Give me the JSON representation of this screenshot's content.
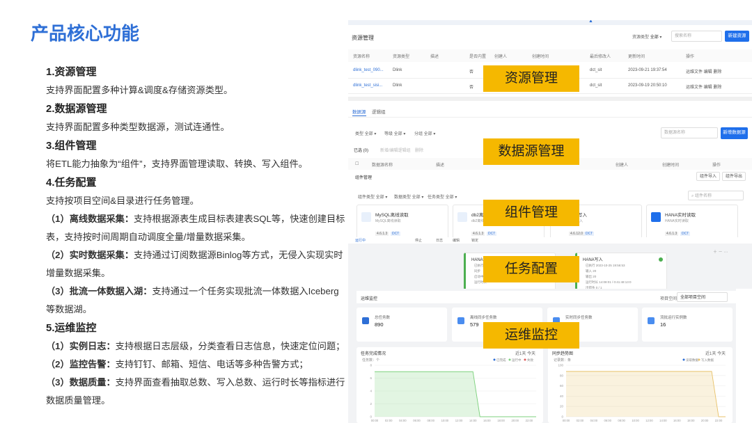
{
  "page": {
    "title": "产品核心功能"
  },
  "features": [
    {
      "heading": "1.资源管理",
      "lines": [
        {
          "bold": "",
          "text": "支持界面配置多种计算&调度&存储资源类型。"
        }
      ]
    },
    {
      "heading": "2.数据源管理",
      "lines": [
        {
          "bold": "",
          "text": "支持界面配置多种类型数据源，测试连通性。"
        }
      ]
    },
    {
      "heading": "3.组件管理",
      "lines": [
        {
          "bold": "",
          "text": "将ETL能力抽象为“组件”，支持界面管理读取、转换、写入组件。"
        }
      ]
    },
    {
      "heading": "4.任务配置",
      "lines": [
        {
          "bold": "",
          "text": "支持按项目空间&目录进行任务管理。"
        },
        {
          "bold": "（1）离线数据采集：",
          "text": "支持根据源表生成目标表建表SQL等，快速创建目标表，支持按时间周期自动调度全量/增量数据采集。"
        },
        {
          "bold": "（2）实时数据采集：",
          "text": "支持通过订阅数据源Binlog等方式，无侵入实现实时增量数据采集。"
        },
        {
          "bold": "（3）批流一体数据入湖：",
          "text": "支持通过一个任务实现批流一体数据入Iceberg等数据湖。"
        }
      ]
    },
    {
      "heading": "5.运维监控",
      "lines": [
        {
          "bold": "（1）实例日志：",
          "text": "支持根据日志层级，分类查看日志信息，快速定位问题；"
        },
        {
          "bold": "（2）监控告警：",
          "text": "支持钉钉、邮箱、短信、电话等多种告警方式；"
        },
        {
          "bold": "（3）数据质量：",
          "text": "支持界面查看抽取总数、写入总数、运行时长等指标进行数据质量管理。"
        }
      ]
    }
  ],
  "overlays": [
    "资源管理",
    "数据源管理",
    "组件管理",
    "任务配置",
    "运维监控"
  ],
  "resource": {
    "title": "资源管理",
    "filter_label": "资源类型",
    "filter_value": "全部",
    "search_placeholder": "搜索名称",
    "new_button": "新建资源",
    "columns": [
      "资源名称",
      "资源类型",
      "描述",
      "是否内置",
      "创建人",
      "创建时间",
      "最后修改人",
      "更新时间",
      "操作"
    ],
    "rows": [
      {
        "name": "dlink_test_090...",
        "type": "Dlink",
        "builtin": "否",
        "modifier": "dct_sit",
        "updated": "2023-09-21 19:37:54",
        "ops": "运维文件  编辑  删除"
      },
      {
        "name": "dlink_test_sisi...",
        "type": "Dlink",
        "builtin": "否",
        "modifier": "dct_sit",
        "updated": "2023-09-19 20:50:10",
        "ops": "运维文件  编辑  删除"
      }
    ]
  },
  "datasource": {
    "tabs": [
      "数据源",
      "逻辑组"
    ],
    "filters": [
      "类型  全部",
      "等级  全部",
      "分组  全部"
    ],
    "search_placeholder": "数据源名称",
    "new_button": "新增数据源",
    "selected": "已选 (0)",
    "batch": "新增/编辑逻辑组",
    "delete": "删除",
    "columns": [
      "数据源名称",
      "描述",
      "创建人",
      "创建时间",
      "操作"
    ]
  },
  "components": {
    "title": "组件管理",
    "btn1": "组件导入",
    "btn2": "组件导出",
    "filters": [
      "组件类型  全部",
      "数据类型  全部",
      "任务类型  全部"
    ],
    "search_placeholder": "组件名称",
    "cards": [
      {
        "name": "MySQL离线读取",
        "sub": "MySQL离线读取",
        "ver": "4.6.1.3",
        "tag": "DCT"
      },
      {
        "name": "db2离线读取",
        "sub": "db2离线读取",
        "ver": "4.6.1.3",
        "tag": "DCT"
      },
      {
        "name": "离线写入",
        "sub": "离线写入",
        "ver": "4.6.12.0",
        "tag": "DCT"
      },
      {
        "name": "HANA实时读取",
        "sub": "HANA实时读取",
        "ver": "4.6.1.3",
        "tag": "DCT"
      }
    ]
  },
  "task": {
    "toolbar": [
      "运行中",
      "停止",
      "日志",
      "编辑",
      "锁定"
    ],
    "node1": {
      "name": "HANA读取",
      "lines": [
        "已执行",
        "同步",
        "启动中",
        "运行时长"
      ]
    },
    "node2": {
      "name": "HANA写入",
      "lines": [
        "已执行  2023-10-25 19:56:53",
        "输入  20",
        "输出  20",
        "运行时长  14:08:01 / 0:41:48:13:0",
        "出错条  0 / 1"
      ]
    }
  },
  "ops": {
    "title": "运维监控",
    "project_label": "项目空间",
    "project_value": "全部项目空间",
    "stats": [
      {
        "label": "总任务数",
        "value": "890"
      },
      {
        "label": "离线同步任务数",
        "value": "579"
      },
      {
        "label": "实时同步任务数",
        "value": "295"
      },
      {
        "label": "流批运行实例数",
        "value": "16"
      }
    ],
    "chart1": {
      "title": "任务完成情况",
      "range": "近1天  今天",
      "ylabel": "任务数：个",
      "legend": [
        "已完成",
        "运行中",
        "失败"
      ]
    },
    "chart2": {
      "title": "同步趋势图",
      "range": "近1天  今天",
      "ylabel": "记录数：条",
      "legend": [
        "读取数据",
        "写入数据"
      ]
    }
  },
  "chart_data": [
    {
      "type": "area",
      "title": "任务完成情况",
      "ylabel": "任务数：个",
      "x": [
        "00:00",
        "01:00",
        "02:00",
        "03:00",
        "04:00",
        "05:00",
        "06:00",
        "07:00",
        "08:00",
        "09:00",
        "10:00",
        "11:00",
        "12:00",
        "13:00",
        "14:00",
        "15:00",
        "16:00",
        "17:00",
        "18:00",
        "19:00",
        "20:00",
        "21:00",
        "22:00",
        "23:00"
      ],
      "ylim": [
        0,
        8
      ],
      "yticks": [
        0,
        2,
        4,
        6,
        8
      ],
      "series": [
        {
          "name": "已完成",
          "values": [
            7,
            7,
            7,
            7,
            7,
            7,
            7,
            7,
            7,
            7,
            7,
            7,
            7,
            7,
            7,
            0,
            0,
            0,
            0,
            0,
            0,
            0,
            0,
            0
          ],
          "color": "#7cd17c"
        }
      ]
    },
    {
      "type": "area",
      "title": "同步趋势图",
      "ylabel": "记录数：条",
      "x": [
        "00:00",
        "01:00",
        "02:00",
        "03:00",
        "04:00",
        "05:00",
        "06:00",
        "07:00",
        "08:00",
        "09:00",
        "10:00",
        "11:00",
        "12:00",
        "13:00",
        "14:00",
        "15:00",
        "16:00",
        "17:00",
        "18:00",
        "19:00",
        "20:00",
        "21:00",
        "22:00",
        "23:00"
      ],
      "ylim": [
        0,
        100
      ],
      "yticks": [
        0,
        20,
        40,
        60,
        80,
        100
      ],
      "series": [
        {
          "name": "写入数据",
          "values": [
            88,
            88,
            88,
            88,
            88,
            88,
            88,
            88,
            88,
            88,
            88,
            88,
            88,
            88,
            88,
            88,
            88,
            88,
            88,
            88,
            88,
            88,
            0,
            0
          ],
          "color": "#e8c26a"
        }
      ]
    }
  ]
}
